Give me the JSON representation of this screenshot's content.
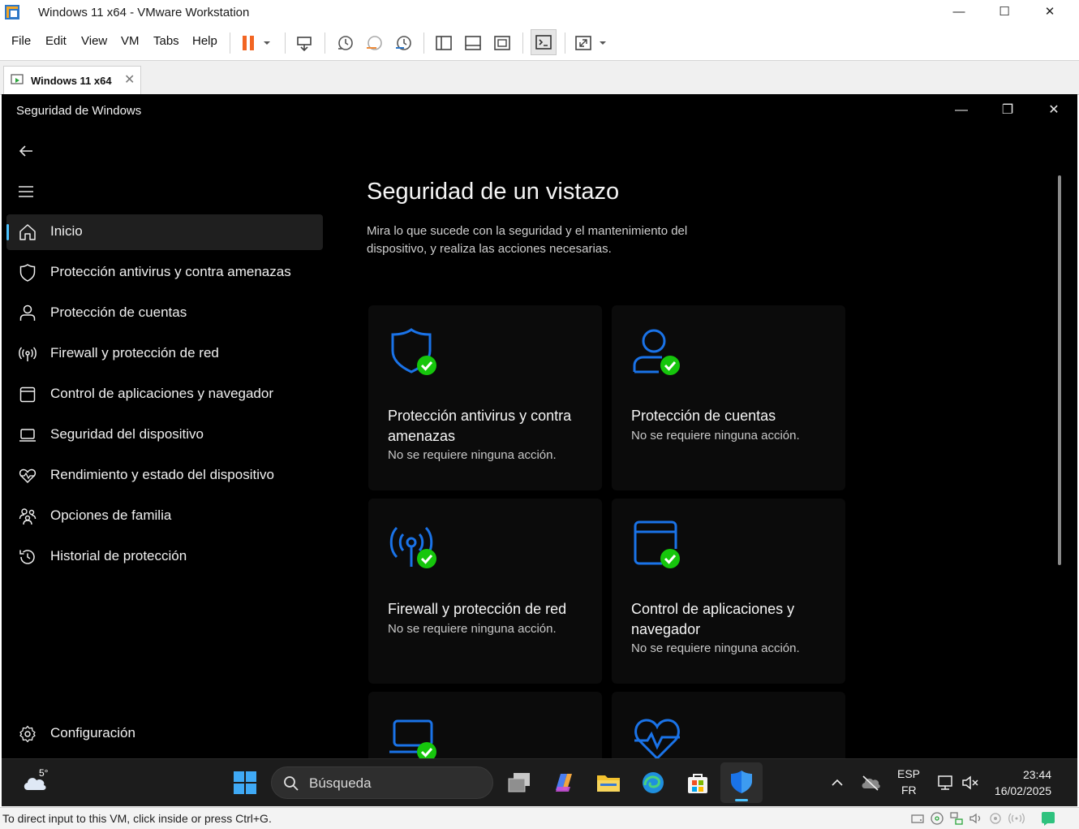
{
  "vmware": {
    "window_title": "Windows 11 x64 - VMware Workstation",
    "controls": {
      "minimize": "—",
      "maximize": "☐",
      "close": "✕"
    },
    "menu": [
      "File",
      "Edit",
      "View",
      "VM",
      "Tabs",
      "Help"
    ],
    "tab_label": "Windows 11 x64",
    "status_text": "To direct input to this VM, click inside or press Ctrl+G."
  },
  "app": {
    "title": "Seguridad de Windows",
    "controls": {
      "minimize": "—",
      "restore": "❐",
      "close": "✕"
    },
    "nav": [
      {
        "label": "Inicio",
        "icon": "home-icon",
        "active": true
      },
      {
        "label": "Protección antivirus y contra amenazas",
        "icon": "shield-icon"
      },
      {
        "label": "Protección de cuentas",
        "icon": "person-icon"
      },
      {
        "label": "Firewall y protección de red",
        "icon": "antenna-icon"
      },
      {
        "label": "Control de aplicaciones y navegador",
        "icon": "app-window-icon"
      },
      {
        "label": "Seguridad del dispositivo",
        "icon": "laptop-icon"
      },
      {
        "label": "Rendimiento y estado del dispositivo",
        "icon": "heart-icon"
      },
      {
        "label": "Opciones de familia",
        "icon": "family-icon"
      },
      {
        "label": "Historial de protección",
        "icon": "history-icon"
      }
    ],
    "settings_label": "Configuración",
    "main": {
      "heading": "Seguridad de un vistazo",
      "description": "Mira lo que sucede con la seguridad y el mantenimiento del dispositivo, y realiza las acciones necesarias.",
      "cards": [
        {
          "title": "Protección antivirus y contra amenazas",
          "status": "No se requiere ninguna acción.",
          "icon": "shield-check-icon"
        },
        {
          "title": "Protección de cuentas",
          "status": "No se requiere ninguna acción.",
          "icon": "person-check-icon"
        },
        {
          "title": "Firewall y protección de red",
          "status": "No se requiere ninguna acción.",
          "icon": "antenna-check-icon"
        },
        {
          "title": "Control de aplicaciones y navegador",
          "status": "No se requiere ninguna acción.",
          "icon": "app-window-check-icon"
        },
        {
          "title": "",
          "status": "",
          "icon": "laptop-check-icon"
        },
        {
          "title": "",
          "status": "",
          "icon": "heart-pulse-icon"
        }
      ]
    },
    "accent_color": "#1a73e8",
    "check_color": "#16c60c"
  },
  "taskbar": {
    "weather_temp": "5°",
    "search_placeholder": "Búsqueda",
    "lang_top": "ESP",
    "lang_bottom": "FR",
    "time": "23:44",
    "date": "16/02/2025"
  }
}
